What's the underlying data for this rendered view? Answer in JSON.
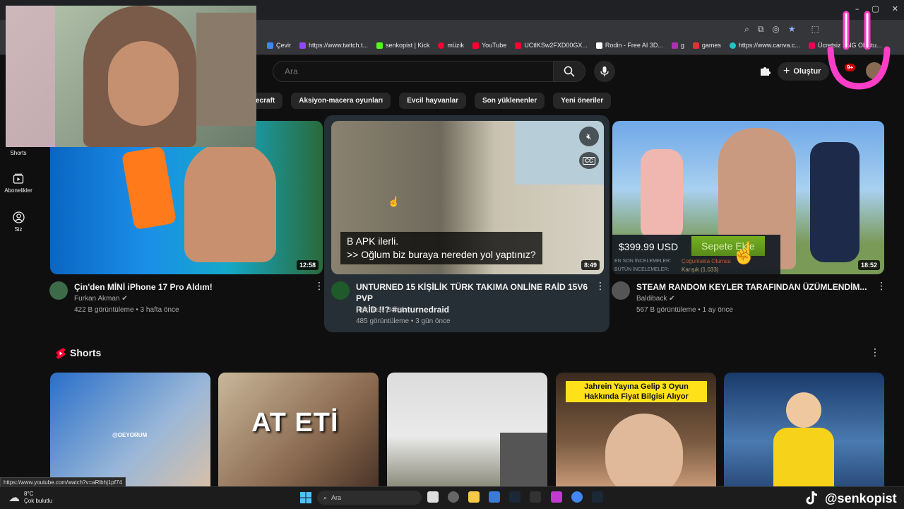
{
  "browser": {
    "window_controls": [
      "–",
      "▢",
      "✕"
    ],
    "bookmarks": [
      {
        "label": "Çevir",
        "color": "#4285f4"
      },
      {
        "label": "https://www.twitch.t...",
        "color": "#9146ff"
      },
      {
        "label": "senkopist | Kick",
        "color": "#53fc18"
      },
      {
        "label": "müzik",
        "color": "#ff0033"
      },
      {
        "label": "YouTube",
        "color": "#ff0033"
      },
      {
        "label": "UCtlKSw2FXD00GX...",
        "color": "#ff0033"
      },
      {
        "label": "Rodin - Free AI 3D...",
        "color": "#ffffff"
      },
      {
        "label": "g",
        "color": "#aa33aa"
      },
      {
        "label": "games",
        "color": "#d33"
      },
      {
        "label": "https://www.canva.c...",
        "color": "#20c4cb"
      },
      {
        "label": "Ücretsiz PNG Oluştu...",
        "color": "#e05"
      }
    ]
  },
  "header": {
    "search_placeholder": "Ara",
    "create_label": "Oluştur",
    "notification_count": "9+"
  },
  "chips": [
    "ecraft",
    "Aksiyon-macera oyunları",
    "Evcil hayvanlar",
    "Son yüklenenler",
    "Yeni öneriler"
  ],
  "sidebar": [
    {
      "label": "Shorts"
    },
    {
      "label": "Abonelikler"
    },
    {
      "label": "Siz"
    }
  ],
  "videos": [
    {
      "title": "Çin'den MİNİ iPhone 17 Pro Aldım!",
      "channel": "Furkan Akman",
      "meta": "422 B görüntüleme • 3 hafta önce",
      "duration": "12:58"
    },
    {
      "title_line1": "UNTURNED 15 KİŞİLİK TÜRK TAKIMA ONLİNE RAİD 15V6 PVP",
      "title_line2": "RAİD !!? #unturnedraid",
      "channel": "Pekmezli Börek",
      "meta": "485 görüntüleme • 3 gün önce",
      "duration": "8:49",
      "caption_line1": "B APK ilerli.",
      "caption_line2": ">> Oğlum biz buraya nereden yol yaptınız?",
      "cc_label": "CC"
    },
    {
      "title": "STEAM RANDOM KEYLER TARAFINDAN ÜZÜMLENDİM...",
      "channel": "Baldiback",
      "meta": "567 B görüntüleme • 1 ay önce",
      "duration": "18:52",
      "price": "$399.99 USD",
      "cart_label": "Sepete Ekle",
      "review_recent_label": "EN SON İNCELEMELER:",
      "review_recent_value": "Çoğunlukla Olumsu",
      "review_all_label": "BÜTÜN İNCELEMELER:",
      "review_all_value": "Karışık (1.033)"
    }
  ],
  "shorts": {
    "title": "Shorts",
    "items": [
      {
        "overlay": "@OEYORUM"
      },
      {
        "overlay": "AT ETİ"
      },
      {
        "overlay": ""
      },
      {
        "overlay": "Jahrein Yayına Gelip 3 Oyun Hakkında Fiyat Bilgisi Alıyor"
      },
      {
        "overlay": ""
      }
    ]
  },
  "status_url": "https://www.youtube.com/watch?v=aRlbhj1pf74",
  "taskbar": {
    "temp": "8°C",
    "weather": "Çok bulutlu",
    "search_label": "Ara"
  },
  "watermark": "@senkopist"
}
